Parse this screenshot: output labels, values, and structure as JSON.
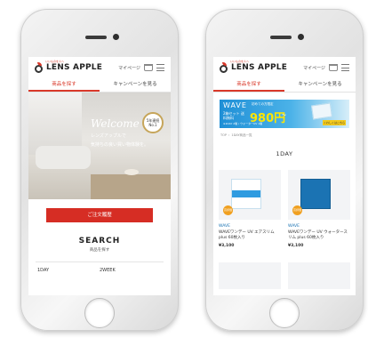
{
  "header": {
    "logo_small": "いいものを人へ",
    "logo_text": "LENS APPLE",
    "mypage_label": "マイページ"
  },
  "tabs": {
    "find": "商品を探す",
    "campaign": "キャンペーンを見る"
  },
  "left_screen": {
    "hero_welcome": "Welcome",
    "hero_line1": "レンズアップルで",
    "hero_line2": "気持ちの良い買い物体験を。",
    "badge_text": "5年連続 No.1",
    "cta_label": "ご注文履歴",
    "search_title": "SEARCH",
    "search_sub": "商品を探す",
    "categories": [
      "1DAY",
      "2WEEK"
    ]
  },
  "right_screen": {
    "banner": {
      "brand": "WAVE",
      "sub": "初めての方限定",
      "set_text": "2箱セット 送料無料",
      "price": "980円",
      "tilde": "〜",
      "note": "※1DAY 2箱 / ウォーターUV 1箱",
      "button": "くわしくはこちら"
    },
    "breadcrumb": [
      "TOP",
      "1DAY商品一覧"
    ],
    "list_title": "1DAY",
    "products": [
      {
        "brand": "WAVE",
        "name": "WAVEワンデー UV エアスリム plus 60枚入り",
        "price": "¥3,100",
        "badge": "高評価"
      },
      {
        "brand": "WAVE",
        "name": "WAVEワンデー UV ウォータースリム plus 60枚入り",
        "price": "¥3,100",
        "badge": "高評価"
      }
    ]
  }
}
